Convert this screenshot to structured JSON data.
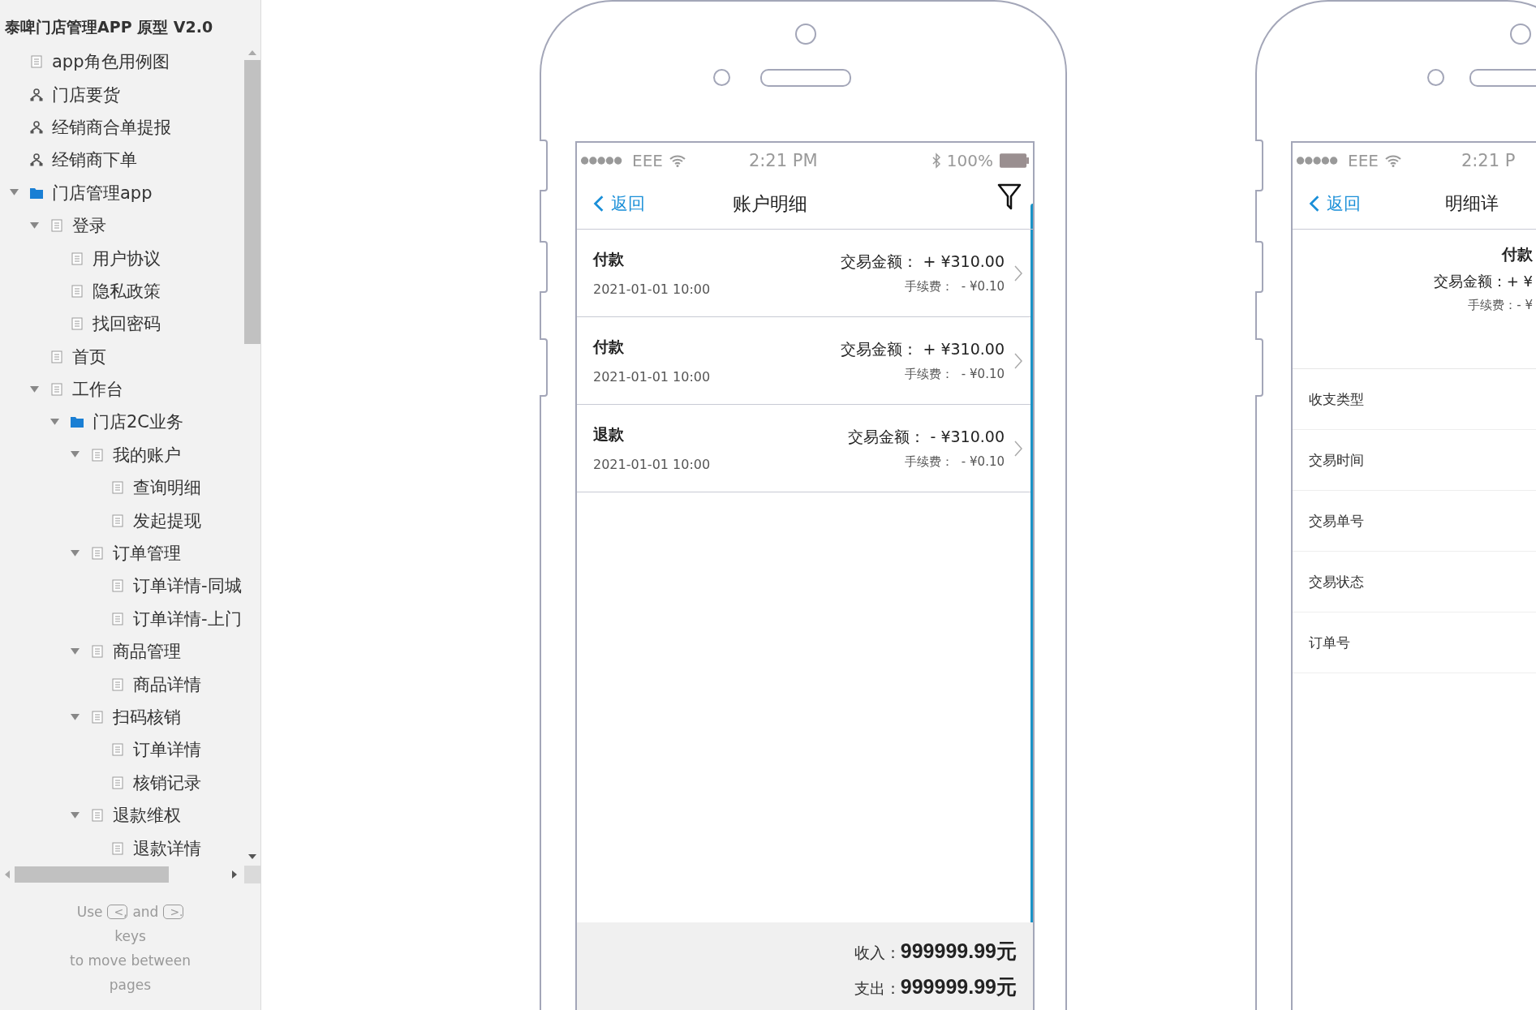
{
  "sidebar": {
    "title": "泰啤门店管理APP 原型 V2.0",
    "tree": [
      {
        "label": "app角色用例图",
        "kind": "page"
      },
      {
        "label": "门店要货",
        "kind": "flow"
      },
      {
        "label": "经销商合单提报",
        "kind": "flow"
      },
      {
        "label": "经销商下单",
        "kind": "flow"
      },
      {
        "label": "门店管理app",
        "kind": "folder",
        "expanded": true,
        "children": [
          {
            "label": "登录",
            "kind": "page",
            "expanded": true,
            "children": [
              {
                "label": "用户协议",
                "kind": "page"
              },
              {
                "label": "隐私政策",
                "kind": "page"
              },
              {
                "label": "找回密码",
                "kind": "page"
              }
            ]
          },
          {
            "label": "首页",
            "kind": "page"
          },
          {
            "label": "工作台",
            "kind": "page",
            "expanded": true,
            "children": [
              {
                "label": "门店2C业务",
                "kind": "folder",
                "expanded": true,
                "children": [
                  {
                    "label": "我的账户",
                    "kind": "page",
                    "expanded": true,
                    "children": [
                      {
                        "label": "查询明细",
                        "kind": "page"
                      },
                      {
                        "label": "发起提现",
                        "kind": "page"
                      }
                    ]
                  },
                  {
                    "label": "订单管理",
                    "kind": "page",
                    "expanded": true,
                    "children": [
                      {
                        "label": "订单详情-同城",
                        "kind": "page"
                      },
                      {
                        "label": "订单详情-上门",
                        "kind": "page"
                      }
                    ]
                  },
                  {
                    "label": "商品管理",
                    "kind": "page",
                    "expanded": true,
                    "children": [
                      {
                        "label": "商品详情",
                        "kind": "page"
                      }
                    ]
                  },
                  {
                    "label": "扫码核销",
                    "kind": "page",
                    "expanded": true,
                    "children": [
                      {
                        "label": "订单详情",
                        "kind": "page"
                      },
                      {
                        "label": "核销记录",
                        "kind": "page"
                      }
                    ]
                  },
                  {
                    "label": "退款维权",
                    "kind": "page",
                    "expanded": true,
                    "children": [
                      {
                        "label": "退款详情",
                        "kind": "page"
                      }
                    ]
                  }
                ]
              }
            ]
          }
        ]
      }
    ],
    "hint": {
      "use": "Use",
      "key_prev": "<,",
      "and": "and",
      "key_next": ">.",
      "keys": "keys",
      "move": "to move between",
      "pages": "pages"
    }
  },
  "account_screen": {
    "status": {
      "carrier": "EEE",
      "time": "2:21 PM",
      "battery": "100%"
    },
    "back": "返回",
    "title": "账户明细",
    "rows": [
      {
        "type": "付款",
        "time": "2021-01-01 10:00",
        "amount_label": "交易金额：",
        "amount": "+ ¥310.00",
        "fee_label": "手续费：",
        "fee": "- ¥0.10"
      },
      {
        "type": "付款",
        "time": "2021-01-01 10:00",
        "amount_label": "交易金额：",
        "amount": "+ ¥310.00",
        "fee_label": "手续费：",
        "fee": "- ¥0.10"
      },
      {
        "type": "退款",
        "time": "2021-01-01 10:00",
        "amount_label": "交易金额：",
        "amount": "- ¥310.00",
        "fee_label": "手续费：",
        "fee": "- ¥0.10"
      }
    ],
    "summary": [
      {
        "label": "收入：",
        "value": "999999.99元"
      },
      {
        "label": "支出：",
        "value": "999999.99元"
      }
    ]
  },
  "detail_screen": {
    "status": {
      "carrier": "EEE",
      "time": "2:21 P"
    },
    "back": "返回",
    "title": "明细详",
    "header": {
      "type": "付款",
      "amount": "交易金额：+ ¥",
      "fee": "手续费：- ¥"
    },
    "fields": [
      "收支类型",
      "交易时间",
      "交易单号",
      "交易状态",
      "订单号"
    ]
  }
}
